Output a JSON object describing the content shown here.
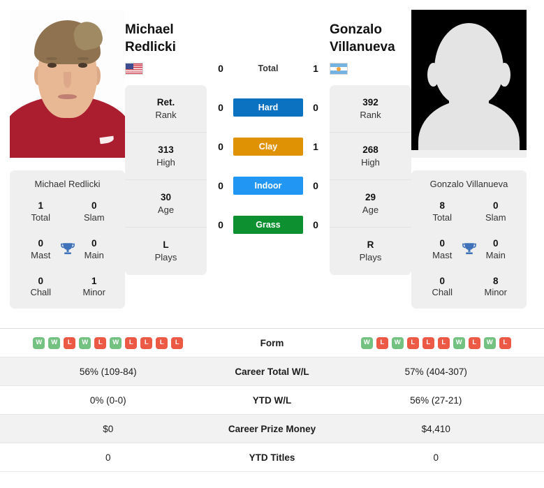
{
  "players": {
    "left": {
      "first_name": "Michael",
      "last_name": "Redlicki",
      "full_name": "Michael Redlicki",
      "country": "us",
      "country_label": "United States",
      "photo_type": "portrait-photo",
      "info": [
        {
          "value": "Ret.",
          "label": "Rank"
        },
        {
          "value": "313",
          "label": "High"
        },
        {
          "value": "30",
          "label": "Age"
        },
        {
          "value": "L",
          "label": "Plays"
        }
      ],
      "titles": [
        {
          "value": "1",
          "label": "Total"
        },
        {
          "value": "0",
          "label": "Slam"
        },
        {
          "value": "0",
          "label": "Mast"
        },
        {
          "value": "0",
          "label": "Main"
        },
        {
          "value": "0",
          "label": "Chall"
        },
        {
          "value": "1",
          "label": "Minor"
        }
      ],
      "form": [
        "W",
        "W",
        "L",
        "W",
        "L",
        "W",
        "L",
        "L",
        "L",
        "L"
      ],
      "career_total_wl": "56% (109-84)",
      "ytd_wl": "0% (0-0)",
      "career_prize_money": "$0",
      "ytd_titles": "0"
    },
    "right": {
      "first_name": "Gonzalo",
      "last_name": "Villanueva",
      "full_name": "Gonzalo Villanueva",
      "country": "ar",
      "country_label": "Argentina",
      "photo_type": "placeholder-silhouette",
      "info": [
        {
          "value": "392",
          "label": "Rank"
        },
        {
          "value": "268",
          "label": "High"
        },
        {
          "value": "29",
          "label": "Age"
        },
        {
          "value": "R",
          "label": "Plays"
        }
      ],
      "titles": [
        {
          "value": "8",
          "label": "Total"
        },
        {
          "value": "0",
          "label": "Slam"
        },
        {
          "value": "0",
          "label": "Mast"
        },
        {
          "value": "0",
          "label": "Main"
        },
        {
          "value": "0",
          "label": "Chall"
        },
        {
          "value": "8",
          "label": "Minor"
        }
      ],
      "form": [
        "W",
        "L",
        "W",
        "L",
        "L",
        "L",
        "W",
        "L",
        "W",
        "L"
      ],
      "career_total_wl": "57% (404-307)",
      "ytd_wl": "56% (27-21)",
      "career_prize_money": "$4,410",
      "ytd_titles": "0"
    }
  },
  "h2h": {
    "total": {
      "label": "Total",
      "left": "0",
      "right": "1"
    },
    "surfaces": [
      {
        "label": "Hard",
        "left": "0",
        "right": "0",
        "color": "#0b71c1"
      },
      {
        "label": "Clay",
        "left": "0",
        "right": "1",
        "color": "#e09205"
      },
      {
        "label": "Indoor",
        "left": "0",
        "right": "0",
        "color": "#2196f3"
      },
      {
        "label": "Grass",
        "left": "0",
        "right": "0",
        "color": "#0d9130"
      }
    ]
  },
  "table": {
    "rows": [
      {
        "label": "Form",
        "left": "",
        "right": "",
        "type": "form",
        "shade": false
      },
      {
        "label": "Career Total W/L",
        "left": "56% (109-84)",
        "right": "57% (404-307)",
        "type": "text",
        "shade": true
      },
      {
        "label": "YTD W/L",
        "left": "0% (0-0)",
        "right": "56% (27-21)",
        "type": "text",
        "shade": false
      },
      {
        "label": "Career Prize Money",
        "left": "$0",
        "right": "$4,410",
        "type": "text",
        "shade": true
      },
      {
        "label": "YTD Titles",
        "left": "0",
        "right": "0",
        "type": "text",
        "shade": false
      }
    ]
  },
  "colors": {
    "hard": "#0b71c1",
    "clay": "#e09205",
    "indoor": "#2196f3",
    "grass": "#0d9130",
    "win": "#73c282",
    "loss": "#ec5a46",
    "card_bg": "#efefef",
    "row_shade": "#f2f2f2"
  }
}
